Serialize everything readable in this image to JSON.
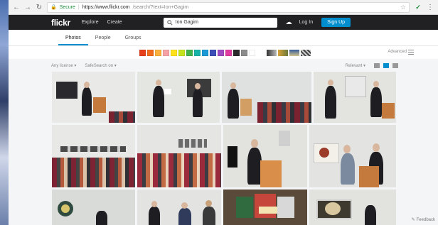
{
  "browser": {
    "back_icon": "arrow-left-icon",
    "forward_icon": "arrow-right-icon",
    "reload_icon": "reload-icon",
    "secure_label": "Secure",
    "url_host": "https://www.flickr.com",
    "url_path": "/search/?text=Ion+Gagim"
  },
  "header": {
    "logo": "flickr",
    "nav": [
      "Explore",
      "Create"
    ],
    "search_value": "Ion Gagim",
    "login_label": "Log In",
    "signup_label": "Sign Up",
    "signup_color": "#008ecf"
  },
  "tabs": [
    {
      "label": "Photos",
      "active": true
    },
    {
      "label": "People",
      "active": false
    },
    {
      "label": "Groups",
      "active": false
    }
  ],
  "color_filters": [
    "#e5401b",
    "#f26b1d",
    "#fbb03b",
    "#f7a3a6",
    "#ffe21c",
    "#c6e41e",
    "#43b34b",
    "#18b3a8",
    "#1c9ad6",
    "#3b4eb8",
    "#9f4bc2",
    "#e23ba0",
    "#2b2b2b",
    "#8c8c8c",
    "#ffffff"
  ],
  "advanced_label": "Advanced",
  "filters": {
    "license": "Any license ▾",
    "safesearch": "SafeSearch on ▾",
    "sort": "Relevant ▾"
  },
  "feedback_label": "Feedback"
}
